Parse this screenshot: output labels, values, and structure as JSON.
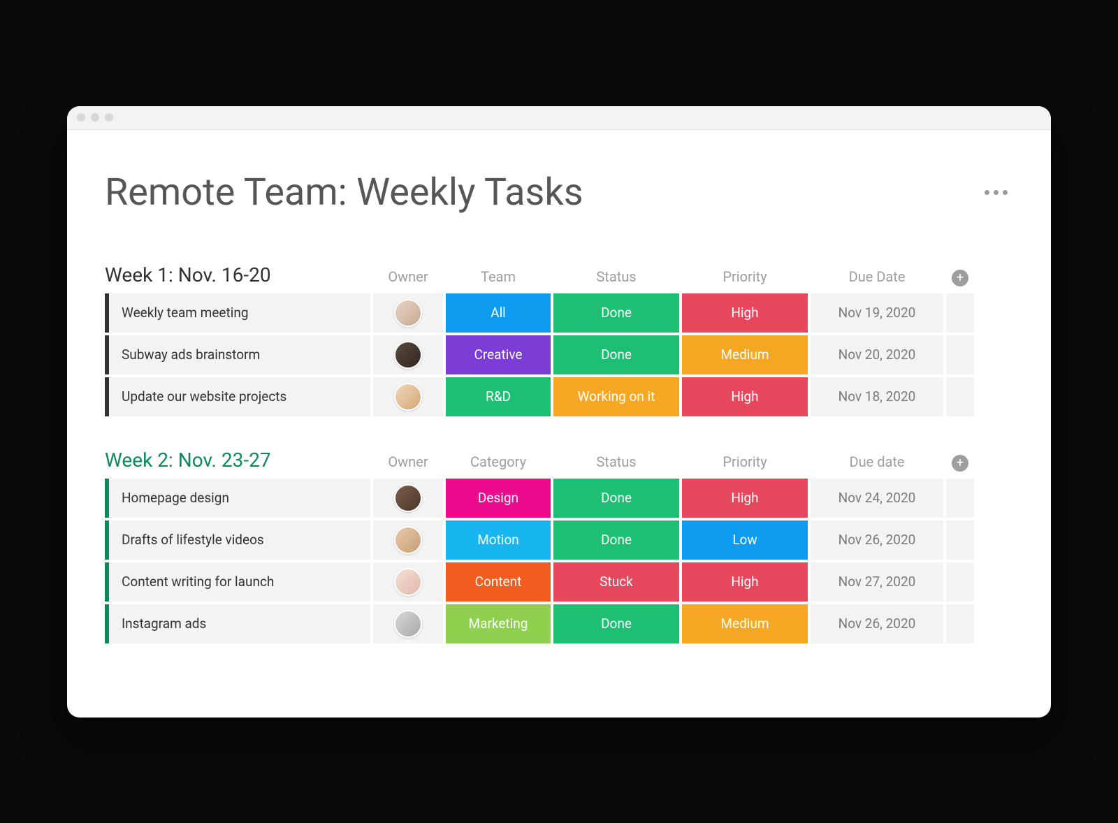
{
  "page": {
    "title": "Remote Team: Weekly Tasks"
  },
  "colors": {
    "blue": "#0d9cf0",
    "purple": "#7b3dd6",
    "green": "#1dbf73",
    "orange": "#f5a623",
    "red": "#e8485e",
    "pink": "#ec0b8d",
    "lightblue": "#18b6f0",
    "deeporange": "#f25c1f",
    "lime": "#8fd14f",
    "grey": "#f3f3f3"
  },
  "groups": [
    {
      "title": "Week 1: Nov. 16-20",
      "title_color": "dark",
      "columns": [
        "Owner",
        "Team",
        "Status",
        "Priority",
        "Due Date"
      ],
      "rows": [
        {
          "task": "Weekly team meeting",
          "avatar": "a1",
          "cells": [
            {
              "label": "All",
              "color": "blue"
            },
            {
              "label": "Done",
              "color": "green"
            },
            {
              "label": "High",
              "color": "red"
            }
          ],
          "due": "Nov 19, 2020"
        },
        {
          "task": "Subway ads brainstorm",
          "avatar": "a2",
          "cells": [
            {
              "label": "Creative",
              "color": "purple"
            },
            {
              "label": "Done",
              "color": "green"
            },
            {
              "label": "Medium",
              "color": "orange"
            }
          ],
          "due": "Nov 20, 2020"
        },
        {
          "task": "Update our website projects",
          "avatar": "a3",
          "cells": [
            {
              "label": "R&D",
              "color": "green"
            },
            {
              "label": "Working on it",
              "color": "orange"
            },
            {
              "label": "High",
              "color": "red"
            }
          ],
          "due": "Nov 18, 2020"
        }
      ]
    },
    {
      "title": "Week 2: Nov. 23-27",
      "title_color": "green",
      "columns": [
        "Owner",
        "Category",
        "Status",
        "Priority",
        "Due date"
      ],
      "rows": [
        {
          "task": "Homepage design",
          "avatar": "a4",
          "cells": [
            {
              "label": "Design",
              "color": "pink"
            },
            {
              "label": "Done",
              "color": "green"
            },
            {
              "label": "High",
              "color": "red"
            }
          ],
          "due": "Nov 24, 2020"
        },
        {
          "task": "Drafts of lifestyle videos",
          "avatar": "a5",
          "cells": [
            {
              "label": "Motion",
              "color": "lightblue"
            },
            {
              "label": "Done",
              "color": "green"
            },
            {
              "label": "Low",
              "color": "blue"
            }
          ],
          "due": "Nov 26, 2020"
        },
        {
          "task": "Content writing for launch",
          "avatar": "a6",
          "cells": [
            {
              "label": "Content",
              "color": "deeporange"
            },
            {
              "label": "Stuck",
              "color": "red"
            },
            {
              "label": "High",
              "color": "red"
            }
          ],
          "due": "Nov 27, 2020"
        },
        {
          "task": "Instagram ads",
          "avatar": "a7",
          "cells": [
            {
              "label": "Marketing",
              "color": "lime"
            },
            {
              "label": "Done",
              "color": "green"
            },
            {
              "label": "Medium",
              "color": "orange"
            }
          ],
          "due": "Nov 26, 2020"
        }
      ]
    }
  ]
}
